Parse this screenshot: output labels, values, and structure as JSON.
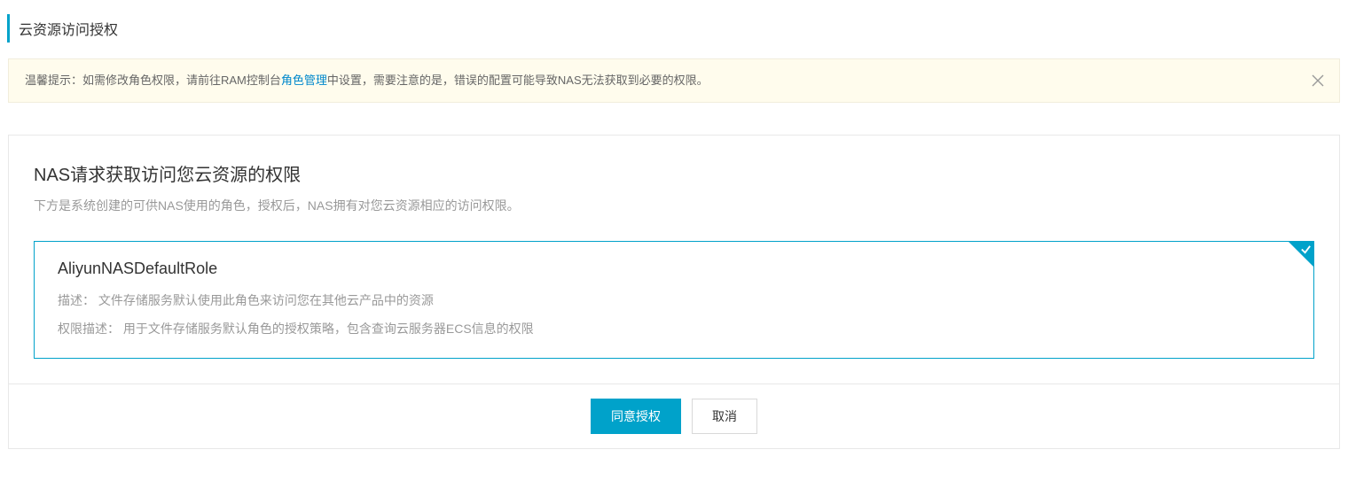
{
  "page": {
    "title": "云资源访问授权"
  },
  "alert": {
    "prefix": "温馨提示：如需修改角色权限，请前往RAM控制台",
    "link_text": "角色管理",
    "suffix": "中设置，需要注意的是，错误的配置可能导致NAS无法获取到必要的权限。"
  },
  "request": {
    "title": "NAS请求获取访问您云资源的权限",
    "subtitle": "下方是系统创建的可供NAS使用的角色，授权后，NAS拥有对您云资源相应的访问权限。"
  },
  "role": {
    "name": "AliyunNASDefaultRole",
    "desc_label": "描述：",
    "desc_value": "文件存储服务默认使用此角色来访问您在其他云产品中的资源",
    "perm_label": "权限描述：",
    "perm_value": "用于文件存储服务默认角色的授权策略，包含查询云服务器ECS信息的权限"
  },
  "footer": {
    "confirm": "同意授权",
    "cancel": "取消"
  }
}
